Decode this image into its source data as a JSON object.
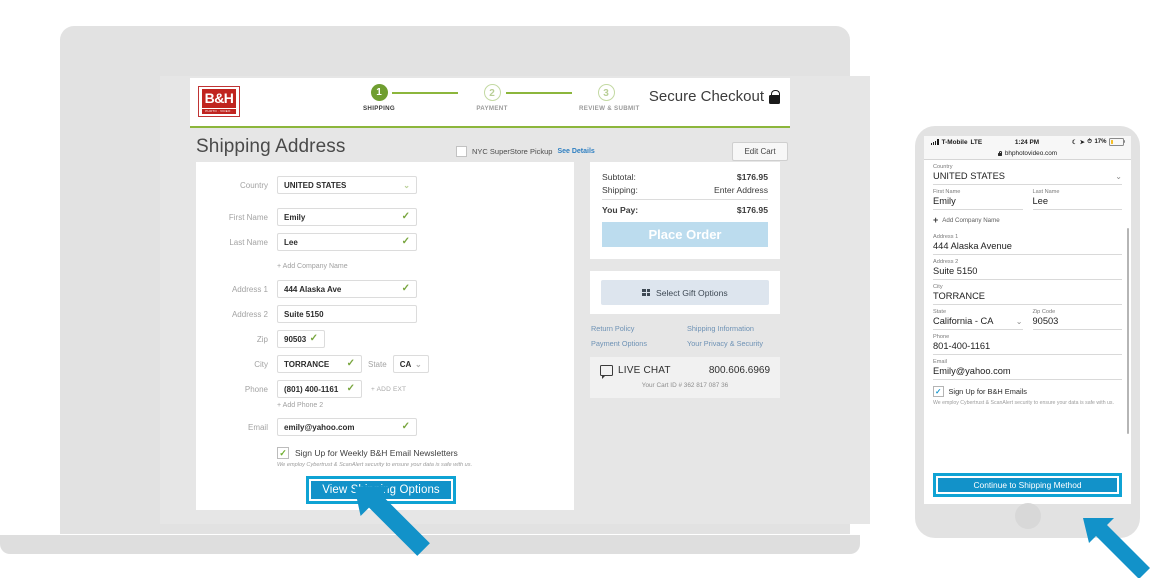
{
  "desktop": {
    "brand": {
      "logo_text": "B&H",
      "logo_sub": "PHOTO · VIDEO · PRO AUDIO"
    },
    "steps": [
      {
        "num": "1",
        "label": "SHIPPING"
      },
      {
        "num": "2",
        "label": "PAYMENT"
      },
      {
        "num": "3",
        "label": "REVIEW & SUBMIT"
      }
    ],
    "secure_label": "Secure Checkout",
    "page_title": "Shipping Address",
    "pickup_label": "NYC SuperStore Pickup",
    "pickup_link": "See Details",
    "edit_cart": "Edit Cart",
    "fields": {
      "country_label": "Country",
      "country_value": "UNITED STATES",
      "first_name_label": "First Name",
      "first_name_value": "Emily",
      "last_name_label": "Last Name",
      "last_name_value": "Lee",
      "add_company": "+ Add Company Name",
      "address1_label": "Address 1",
      "address1_value": "444 Alaska Ave",
      "address2_label": "Address 2",
      "address2_value": "Suite 5150",
      "zip_label": "Zip",
      "zip_value": "90503",
      "city_label": "City",
      "city_value": "TORRANCE",
      "state_label": "State",
      "state_value": "CA",
      "phone_label": "Phone",
      "phone_value": "(801) 400-1161",
      "add_ext": "+ ADD EXT",
      "add_phone2": "+ Add Phone 2",
      "email_label": "Email",
      "email_value": "emily@yahoo.com"
    },
    "newsletter_label": "Sign Up for Weekly B&H Email Newsletters",
    "disclaimer": "We employ Cybertrust & ScanAlert security to ensure your data is safe with us.",
    "cta_label": "View Shipping Options",
    "summary": {
      "subtotal_label": "Subtotal:",
      "subtotal_value": "$176.95",
      "shipping_label": "Shipping:",
      "shipping_value": "Enter Address",
      "youpay_label": "You Pay:",
      "youpay_value": "$176.95",
      "place_order": "Place Order",
      "gift_options": "Select Gift Options",
      "links": [
        "Return Policy",
        "Shipping Information",
        "Payment Options",
        "Your Privacy & Security"
      ],
      "live_chat": "LIVE CHAT",
      "phone_number": "800.606.6969",
      "cart_id": "Your Cart ID # 362 817 087 36"
    }
  },
  "mobile": {
    "status": {
      "carrier": "T-Mobile",
      "network": "LTE",
      "time": "1:24 PM",
      "battery": "17%"
    },
    "url": "bhphotovideo.com",
    "fields": {
      "country_label": "Country",
      "country_value": "UNITED STATES",
      "first_name_label": "First Name",
      "first_name_value": "Emily",
      "last_name_label": "Last Name",
      "last_name_value": "Lee",
      "add_company": "Add Company Name",
      "address1_label": "Address 1",
      "address1_value": "444 Alaska Avenue",
      "address2_label": "Address 2",
      "address2_value": "Suite 5150",
      "city_label": "City",
      "city_value": "TORRANCE",
      "state_label": "State",
      "state_value": "California - CA",
      "zip_label": "Zip Code",
      "zip_value": "90503",
      "phone_label": "Phone",
      "phone_value": "801-400-1161",
      "email_label": "Email",
      "email_value": "Emily@yahoo.com"
    },
    "newsletter_label": "Sign Up for B&H Emails",
    "disclaimer": "We employ Cybertrust & ScanAlert security to ensure your data is safe with us.",
    "cta_label": "Continue to Shipping Method"
  },
  "colors": {
    "accent_blue": "#1292c9",
    "highlight_blue": "#0fa3d4",
    "brand_green": "#8cb63c",
    "brand_red": "#c0241f"
  },
  "icons": {
    "check": "✓",
    "caret": "⌄",
    "plus": "+"
  }
}
